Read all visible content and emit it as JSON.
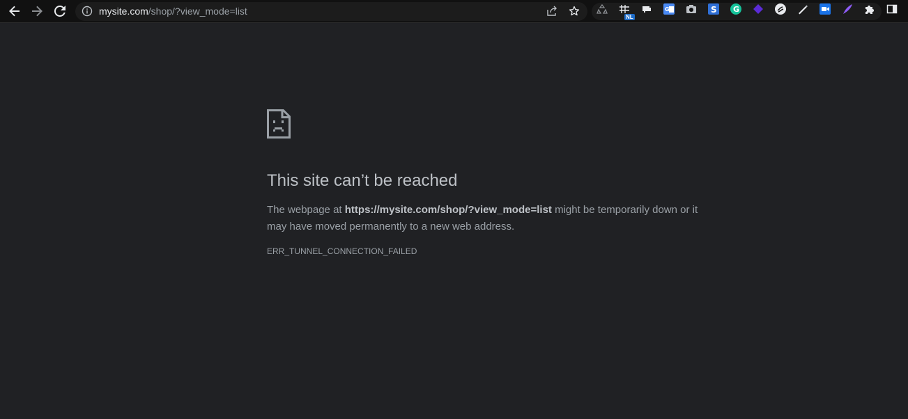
{
  "browser": {
    "url_host": "mysite.com",
    "url_path": "/shop/?view_mode=list",
    "extension_badge": "NL"
  },
  "error_page": {
    "title": "This site can’t be reached",
    "desc_prefix": "The webpage at ",
    "desc_url": "https://mysite.com/shop/?view_mode=list",
    "desc_suffix": " might be temporarily down or it may have moved permanently to a new web address.",
    "error_code": "ERR_TUNNEL_CONNECTION_FAILED"
  },
  "icons": {
    "back": "back-arrow-icon",
    "forward": "forward-arrow-icon",
    "reload": "reload-icon",
    "info": "info-icon",
    "share": "share-icon",
    "bookmark": "star-icon",
    "extensions": "puzzle-icon",
    "side_panel": "side-panel-icon",
    "error": "sad-page-icon"
  },
  "colors": {
    "background": "#202124",
    "toolbar": "#111111",
    "title": "#bdc1c6",
    "text": "#9aa0a6"
  }
}
